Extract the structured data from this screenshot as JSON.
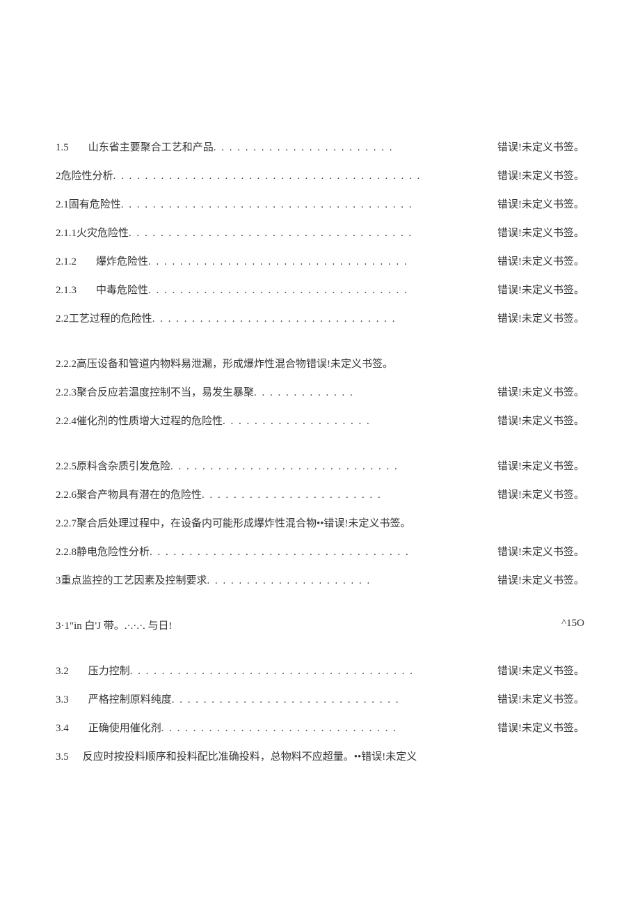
{
  "error_text": "错误!未定义书签。",
  "error_text_short": "错误!未定义",
  "entries": [
    {
      "num": "1.5",
      "gap": true,
      "text": "山东省主要聚合工艺和产品",
      "dots": " . . . . . . . . . . . . . . . . . . . . . . . ",
      "page": "err",
      "spacing": "small"
    },
    {
      "num": "2",
      "gap": false,
      "text": " 危险性分析",
      "dots": " . . . . . . . . . . . . . . . . . . . . . . . . . . . . . . . . . . . . . . . ",
      "page": "err",
      "spacing": "small"
    },
    {
      "num": "2.1",
      "gap": false,
      "text": " 固有危险性",
      "dots": " . . . . . . . . . . . . . . . . . . . . . . . . . . . . . . . . . . . . . ",
      "page": "err",
      "spacing": "small"
    },
    {
      "num": "2.1.1",
      "gap": false,
      "text": " 火灾危险性",
      "dots": " . . . . . . . . . . . . . . . . . . . . . . . . . . . . . . . . . . . . ",
      "page": "err",
      "spacing": "small"
    },
    {
      "num": "2.1.2",
      "gap": true,
      "text": "爆炸危险性",
      "dots": " . . . . . . . . . . . . . . . . . . . . . . . . . . . . . . . . . ",
      "page": "err",
      "spacing": "small"
    },
    {
      "num": "2.1.3",
      "gap": true,
      "text": "中毒危险性",
      "dots": " . . . . . . . . . . . . . . . . . . . . . . . . . . . . . . . . . ",
      "page": "err",
      "spacing": "small"
    },
    {
      "num": "2.2",
      "gap": false,
      "text": " 工艺过程的危险性",
      "dots": " . . . . . . . . . . . . . . . . . . . . . . . . . . . . . . . ",
      "page": "err",
      "spacing": "large"
    },
    {
      "num": "2.2.2",
      "gap": false,
      "text": " 高压设备和管道内物料易泄漏，形成爆炸性混合物",
      "dots": "",
      "page": "err",
      "spacing": "small"
    },
    {
      "num": "2.2.3",
      "gap": false,
      "text": " 聚合反应若温度控制不当，易发生暴聚",
      "dots": " . . . . . . . . . . . . . ",
      "page": "err",
      "spacing": "small"
    },
    {
      "num": "2.2.4",
      "gap": false,
      "text": " 催化剂的性质增大过程的危险性",
      "dots": " . . . . . . . . . . . . . . . . . . . ",
      "page": "err",
      "spacing": "large"
    },
    {
      "num": "2.2.5",
      "gap": false,
      "text": " 原料含杂质引发危险",
      "dots": " . . . . . . . . . . . . . . . . . . . . . . . . . . . . . ",
      "page": "err",
      "spacing": "small"
    },
    {
      "num": "2.2.6",
      "gap": false,
      "text": " 聚合产物具有潜在的危险性",
      "dots": " . . . . . . . . . . . . . . . . . . . . . . . ",
      "page": "err",
      "spacing": "small"
    },
    {
      "num": "2.2.7",
      "gap": false,
      "text": " 聚合后处理过程中，在设备内可能形成爆炸性混合物••",
      "dots": "",
      "page": "err",
      "spacing": "small"
    },
    {
      "num": "2.2.8",
      "gap": false,
      "text": " 静电危险性分析",
      "dots": " . . . . . . . . . . . . . . . . . . . . . . . . . . . . . . . . . ",
      "page": "err",
      "spacing": "small"
    },
    {
      "num": "3",
      "gap": false,
      "text": " 重点监控的工艺因素及控制要求",
      "dots": " . . . . . . . . . . . . . . . . . . . . . ",
      "page": "err",
      "spacing": "large"
    }
  ],
  "special_entry": {
    "left": "3·1\"in 白'J 带。.·.·.·. 与日!",
    "right": "^15O"
  },
  "entries_after": [
    {
      "num": "3.2",
      "gap": true,
      "text": "压力控制",
      "dots": " . . . . . . . . . . . . . . . . . . . . . . . . . . . . . . . . . . . . ",
      "page": "err",
      "spacing": "small"
    },
    {
      "num": "3.3",
      "gap": true,
      "text": "严格控制原料纯度",
      "dots": ". . . . . . . . . . . . . . . . . . . . . . . . . . . . . ",
      "page": "err",
      "spacing": "small"
    },
    {
      "num": "3.4",
      "gap": true,
      "text": "正确使用催化剂",
      "dots": " . . . . . . . . . . . . . . . . . . . . . . . . . . . . . . ",
      "page": "err",
      "spacing": "small"
    },
    {
      "num": "3.5",
      "gap": true,
      "text": "反应时按投料顺序和投料配比准确投料，总物料不应超量。••",
      "dots": "",
      "page": "err_short",
      "spacing": "small"
    }
  ]
}
